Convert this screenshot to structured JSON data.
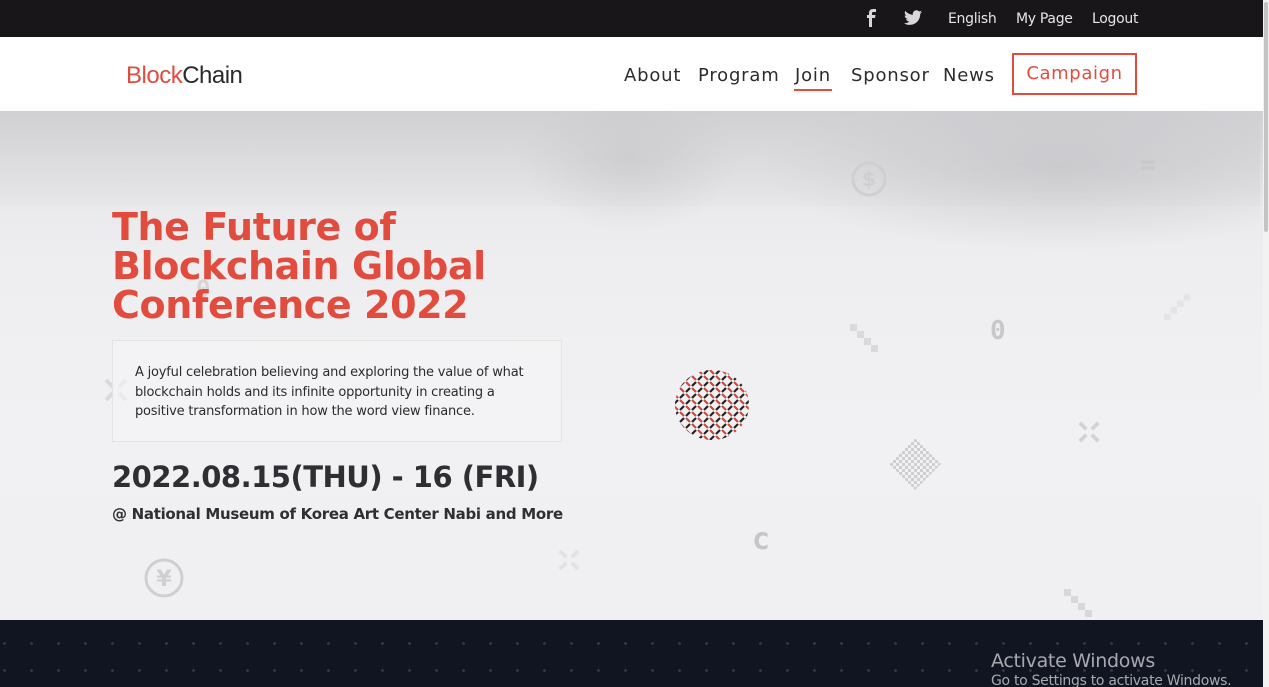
{
  "topbar": {
    "links": {
      "language": "English",
      "mypage": "My Page",
      "logout": "Logout"
    },
    "icons": [
      "facebook-icon",
      "twitter-icon"
    ]
  },
  "header": {
    "logo": {
      "part1": "Block",
      "part2": "Chain"
    },
    "nav": {
      "about": "About",
      "program": "Program",
      "join": "Join",
      "sponsor": "Sponsor",
      "news": "News"
    },
    "active_nav": "Join",
    "campaign_label": "Campaign"
  },
  "hero": {
    "title": "The Future of Blockchain Global Conference 2022",
    "description": "A joyful celebration believing and exploring the value of what blockchain holds and its infinite opportunity in creating a positive transformation in how the word view finance.",
    "date": "2022.08.15(THU) - 16 (FRI)",
    "venue": "@ National Museum of Korea Art Center Nabi and More",
    "decor_glyphs": {
      "zero_a": "0",
      "zero_b": "0",
      "c_glyph": "c",
      "equals": "=",
      "yen_symbol": "¥",
      "dollar_symbol": "$"
    }
  },
  "os_overlay": {
    "line1": "Activate Windows",
    "line2": "Go to Settings to activate Windows."
  },
  "colors": {
    "accent": "#e14c3f",
    "topbar_bg": "#181618",
    "dark_band": "#111522",
    "text_dark": "#2e2e33"
  }
}
